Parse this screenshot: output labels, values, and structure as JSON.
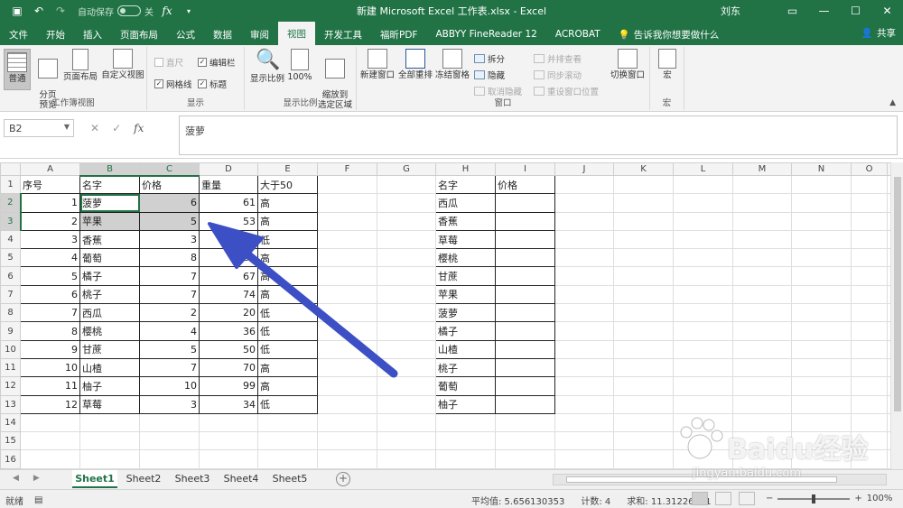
{
  "window": {
    "title": "新建 Microsoft Excel 工作表.xlsx  -  Excel",
    "autosave_label": "自动保存",
    "autosave_state": "关",
    "user": "刘东"
  },
  "tabs": [
    "文件",
    "开始",
    "插入",
    "页面布局",
    "公式",
    "数据",
    "审阅",
    "视图",
    "开发工具",
    "福昕PDF",
    "ABBYY FineReader 12",
    "ACROBAT"
  ],
  "active_tab": "视图",
  "tell_me": "告诉我你想要做什么",
  "share_label": "共享",
  "ribbon": {
    "workbook_views": {
      "label": "工作簿视图",
      "normal": "普通",
      "page_break": "分页\n预览",
      "page_layout": "页面布局",
      "custom": "自定义视图"
    },
    "show": {
      "label": "显示",
      "ruler": "直尺",
      "gridlines": "网格线",
      "formula_bar": "编辑栏",
      "headings": "标题"
    },
    "zoom": {
      "label": "显示比例",
      "zoom": "显示比例",
      "zoom100": "100%",
      "zoom_selection": "缩放到\n选定区域"
    },
    "window": {
      "label": "窗口",
      "new_window": "新建窗口",
      "arrange_all": "全部重排",
      "freeze": "冻结窗格",
      "split": "拆分",
      "hide": "隐藏",
      "unhide": "取消隐藏",
      "side_by_side": "并排查看",
      "sync_scroll": "同步滚动",
      "reset_pos": "重设窗口位置",
      "switch": "切换窗口"
    },
    "macros": {
      "label": "宏",
      "macro": "宏"
    }
  },
  "formula_bar": {
    "name_box": "B2",
    "content": "菠萝"
  },
  "columns": [
    "A",
    "B",
    "C",
    "D",
    "E",
    "F",
    "G",
    "H",
    "I",
    "J",
    "K",
    "L",
    "M",
    "N",
    "O"
  ],
  "rows": [
    [
      "序号",
      "名字",
      "价格",
      "重量",
      "大于50",
      "",
      "",
      "名字",
      "价格"
    ],
    [
      "1",
      "菠萝",
      "6",
      "61",
      "高",
      "",
      "",
      "西瓜",
      ""
    ],
    [
      "2",
      "苹果",
      "5",
      "53",
      "高",
      "",
      "",
      "香蕉",
      ""
    ],
    [
      "3",
      "香蕉",
      "3",
      "28",
      "低",
      "",
      "",
      "草莓",
      ""
    ],
    [
      "4",
      "葡萄",
      "8",
      "81",
      "高",
      "",
      "",
      "樱桃",
      ""
    ],
    [
      "5",
      "橘子",
      "7",
      "67",
      "高",
      "",
      "",
      "甘蔗",
      ""
    ],
    [
      "6",
      "桃子",
      "7",
      "74",
      "高",
      "",
      "",
      "苹果",
      ""
    ],
    [
      "7",
      "西瓜",
      "2",
      "20",
      "低",
      "",
      "",
      "菠萝",
      ""
    ],
    [
      "8",
      "樱桃",
      "4",
      "36",
      "低",
      "",
      "",
      "橘子",
      ""
    ],
    [
      "9",
      "甘蔗",
      "5",
      "50",
      "低",
      "",
      "",
      "山楂",
      ""
    ],
    [
      "10",
      "山楂",
      "7",
      "70",
      "高",
      "",
      "",
      "桃子",
      ""
    ],
    [
      "11",
      "柚子",
      "10",
      "99",
      "高",
      "",
      "",
      "葡萄",
      ""
    ],
    [
      "12",
      "草莓",
      "3",
      "34",
      "低",
      "",
      "",
      "柚子",
      ""
    ],
    [
      "",
      "",
      "",
      "",
      "",
      "",
      "",
      "",
      ""
    ],
    [
      "",
      "",
      "",
      "",
      "",
      "",
      "",
      "",
      ""
    ],
    [
      "",
      "",
      "",
      "",
      "",
      "",
      "",
      "",
      ""
    ]
  ],
  "sheets": [
    "Sheet1",
    "Sheet2",
    "Sheet3",
    "Sheet4",
    "Sheet5"
  ],
  "active_sheet": "Sheet1",
  "status": {
    "mode": "就绪",
    "average": "平均值: 5.656130353",
    "count": "计数: 4",
    "sum": "求和: 11.31226071",
    "zoom": "100%"
  },
  "watermark": {
    "brand": "Baidu经验",
    "url": "jingyan.baidu.com"
  },
  "colors": {
    "excel_green": "#217346",
    "arrow": "#3d4fc4"
  }
}
